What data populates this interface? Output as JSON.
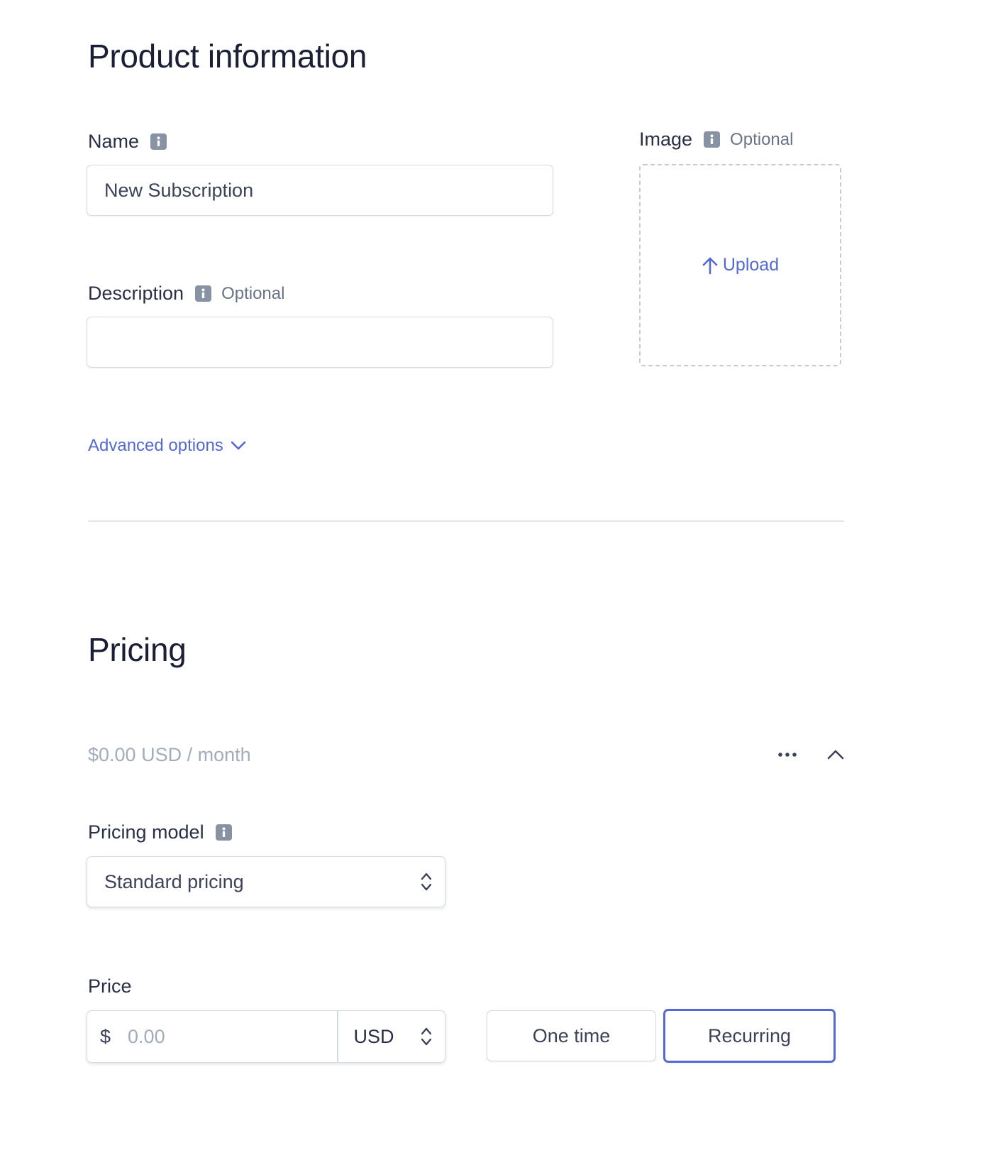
{
  "product": {
    "heading": "Product information",
    "name_label": "Name",
    "name_value": "New Subscription",
    "description_label": "Description",
    "description_optional": "Optional",
    "description_value": "",
    "image_label": "Image",
    "image_optional": "Optional",
    "upload_label": "Upload",
    "advanced_options": "Advanced options"
  },
  "pricing": {
    "heading": "Pricing",
    "summary": "$0.00 USD / month",
    "model_label": "Pricing model",
    "model_value": "Standard pricing",
    "price_label": "Price",
    "currency_symbol": "$",
    "price_placeholder": "0.00",
    "currency": "USD",
    "billing_options": [
      "One time",
      "Recurring"
    ],
    "selected_billing": "Recurring"
  },
  "colors": {
    "accent": "#5469d4",
    "text": "#1a1f36",
    "muted": "#697386",
    "border": "#d5d9e0",
    "icon": "#8792a2"
  },
  "icons": {
    "info": "info-icon",
    "upload": "arrow-up-icon",
    "advanced": "chevron-down-icon",
    "select": "select-arrows-icon",
    "more": "more-horizontal-icon",
    "collapse": "chevron-up-icon"
  }
}
